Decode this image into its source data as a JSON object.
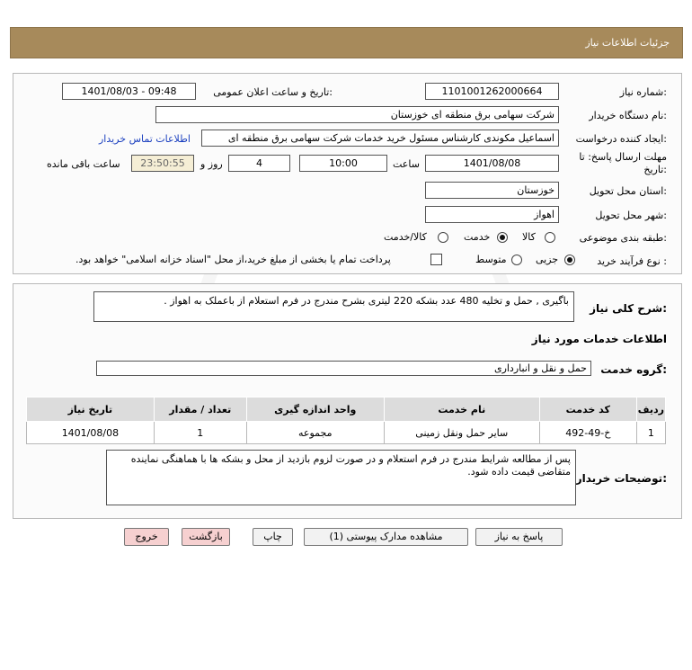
{
  "page_title": "جزئیات اطلاعات نیاز",
  "need_number": {
    "label": "شماره نیاز:",
    "value": "1101001262000664"
  },
  "announce_datetime": {
    "label": "تاریخ و ساعت اعلان عمومی:",
    "value": "1401/08/03 - 09:48"
  },
  "buyer_org": {
    "label": "نام دستگاه خریدار:",
    "value": "شرکت سهامی برق منطقه ای خوزستان"
  },
  "requester": {
    "label": "ایجاد کننده درخواست:",
    "value": "اسماعیل مکوندی کارشناس مسئول خرید خدمات شرکت سهامی برق منطقه ای",
    "contact_link": "اطلاعات تماس خریدار"
  },
  "deadline": {
    "label": "مهلت ارسال پاسخ: تا تاریخ:",
    "date": "1401/08/08",
    "time_label": "ساعت",
    "time": "10:00",
    "days": "4",
    "days_label": "روز و",
    "remaining": "23:50:55",
    "remaining_label": "ساعت باقی مانده"
  },
  "delivery_province": {
    "label": "استان محل تحویل:",
    "value": "خوزستان"
  },
  "delivery_city": {
    "label": "شهر محل تحویل:",
    "value": "اهواز"
  },
  "category": {
    "label": "طبقه بندی موضوعی:",
    "options": [
      "کالا",
      "خدمت",
      "کالا/خدمت"
    ],
    "selected": "خدمت"
  },
  "purchase_process": {
    "label": "نوع فرآیند خرید :",
    "options": [
      "جزیی",
      "متوسط"
    ],
    "selected": "جزیی",
    "payment_note": "پرداخت تمام یا بخشی از مبلغ خرید،از محل \"اسناد خزانه اسلامی\" خواهد بود."
  },
  "general_desc": {
    "label": "شرح کلی نیاز:",
    "value": "باگیری , حمل و تخلیه 480 عدد بشکه 220 لیتری بشرح مندرج در فرم استعلام از باعملک به اهواز ."
  },
  "services_section_title": "اطلاعات خدمات مورد نیاز",
  "service_group": {
    "label": "گروه خدمت:",
    "value": "حمل و نقل و انبارداری"
  },
  "table": {
    "headers": [
      "ردیف",
      "کد خدمت",
      "نام خدمت",
      "واحد اندازه گیری",
      "تعداد / مقدار",
      "تاریخ نیاز"
    ],
    "rows": [
      [
        "1",
        "خ-49-492",
        "سایر حمل ونقل زمینی",
        "مجموعه",
        "1",
        "1401/08/08"
      ]
    ]
  },
  "buyer_notes": {
    "label": "توضیحات خریدار:",
    "value": "پس از مطالعه شرایط مندرج در فرم استعلام و در صورت لزوم بازدید از محل و بشکه ها با هماهنگی نماینده متقاضی قیمت داده شود."
  },
  "buttons": {
    "reply": "پاسخ به نیاز",
    "view_docs": "مشاهده مدارک پیوستی (1)",
    "print": "چاپ",
    "back": "بازگشت",
    "exit": "خروج"
  },
  "watermark": {
    "line1": "ParsNamadData",
    "line2": "مرکز فراهم آوری اطلاعات مناقصه و مزایده",
    "line3": "021-88349670"
  }
}
